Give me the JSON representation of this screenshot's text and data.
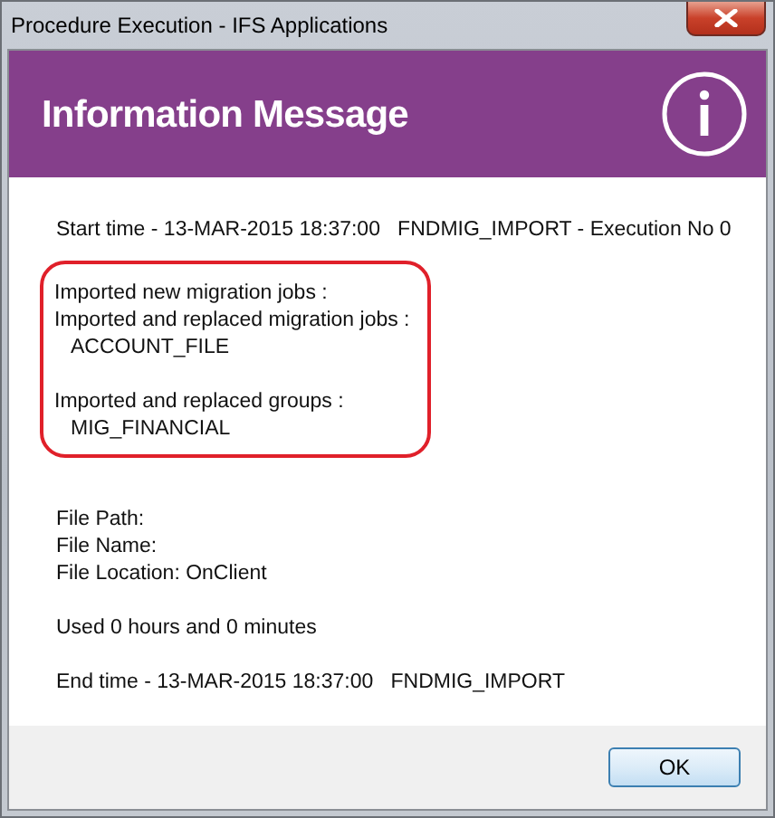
{
  "window": {
    "title": "Procedure Execution - IFS Applications"
  },
  "header": {
    "title": "Information Message"
  },
  "message": {
    "sections": [
      {
        "highlighted": false,
        "groups": [
          [
            {
              "text": "Start time - 13-MAR-2015 18:37:00   FNDMIG_IMPORT - Execution No 0",
              "indent": false
            }
          ]
        ]
      },
      {
        "highlighted": true,
        "groups": [
          [
            {
              "text": "Imported new migration jobs :",
              "indent": false
            },
            {
              "text": "Imported and replaced migration jobs :",
              "indent": false
            },
            {
              "text": "ACCOUNT_FILE",
              "indent": true
            }
          ],
          [
            {
              "text": "Imported and replaced groups :",
              "indent": false
            },
            {
              "text": "MIG_FINANCIAL",
              "indent": true
            }
          ]
        ]
      },
      {
        "highlighted": false,
        "groups": [
          [
            {
              "text": "File Path:",
              "indent": false
            },
            {
              "text": "File Name:",
              "indent": false
            },
            {
              "text": "File Location: OnClient",
              "indent": false
            }
          ],
          [
            {
              "text": "Used 0 hours and 0 minutes",
              "indent": false
            }
          ],
          [
            {
              "text": "End time - 13-MAR-2015 18:37:00   FNDMIG_IMPORT",
              "indent": false
            }
          ]
        ]
      }
    ]
  },
  "buttons": [
    {
      "label": "OK"
    }
  ]
}
